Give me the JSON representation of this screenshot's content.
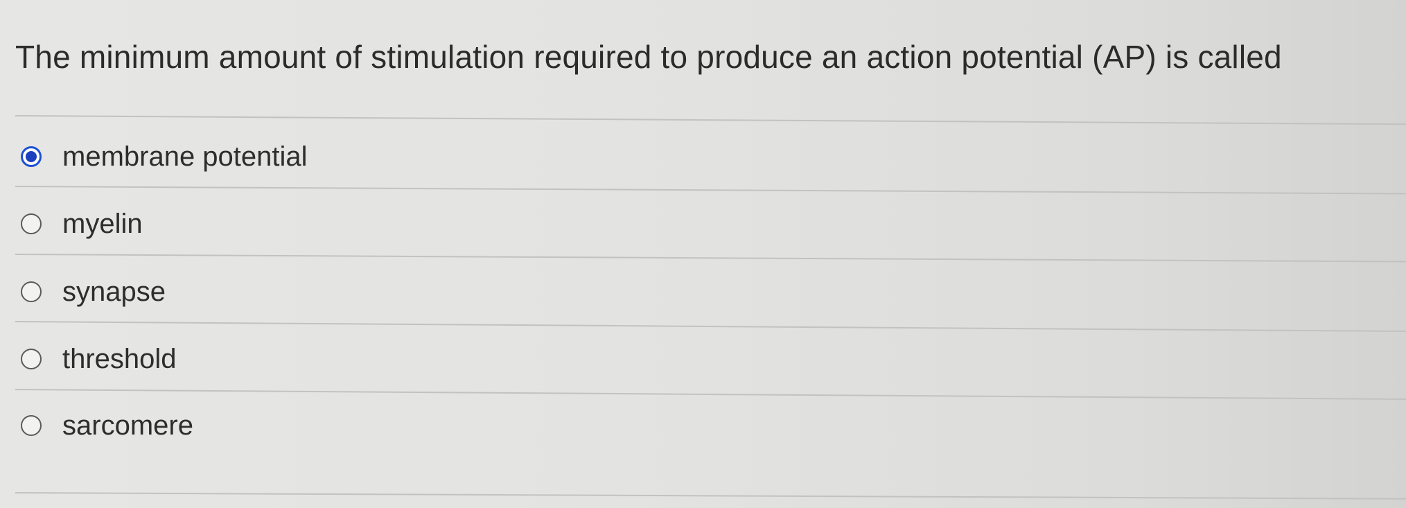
{
  "question": {
    "text": "The minimum amount of stimulation required to produce an action potential (AP) is called"
  },
  "options": [
    {
      "label": "membrane potential",
      "selected": true
    },
    {
      "label": "myelin",
      "selected": false
    },
    {
      "label": "synapse",
      "selected": false
    },
    {
      "label": "threshold",
      "selected": false
    },
    {
      "label": "sarcomere",
      "selected": false
    }
  ],
  "colors": {
    "radio_selected": "#1d4fd6",
    "text": "#2b2b2b",
    "divider": "#c2c3c1"
  }
}
